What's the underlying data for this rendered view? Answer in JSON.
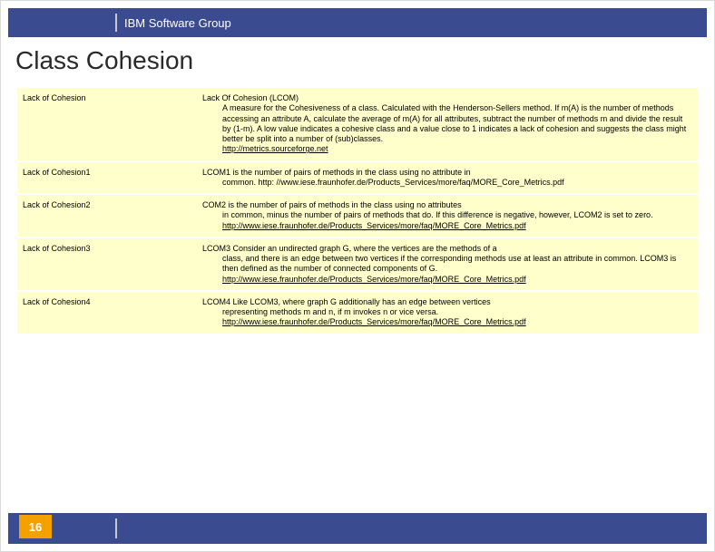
{
  "header": {
    "group": "IBM Software Group"
  },
  "title": "Class Cohesion",
  "page_number": "16",
  "rows": [
    {
      "name": "Lack of Cohesion",
      "head": "Lack Of Cohesion (LCOM)",
      "desc": "A measure for the Cohesiveness of a class. Calculated with the Henderson-Sellers method. If m(A) is the number of methods accessing an attribute A, calculate the average of m(A) for all attributes, subtract the number of methods m and divide the result by (1-m). A low value indicates a cohesive class and a value close to 1 indicates a lack of cohesion and suggests the class might better be split into a number of (sub)classes.",
      "link": "http://metrics.sourceforge.net"
    },
    {
      "name": "Lack of Cohesion1",
      "head": "LCOM1 is the number of pairs of methods in the class using no attribute in",
      "desc": "common. http: //www.iese.fraunhofer.de/Products_Services/more/faq/MORE_Core_Metrics.pdf",
      "link": ""
    },
    {
      "name": "Lack of Cohesion2",
      "head": "COM2 is the number of pairs of methods in the class using no attributes",
      "desc": "in common, minus the number of pairs of methods that do. If this difference is negative, however, LCOM2 is set to zero.",
      "link": "http://www.iese.fraunhofer.de/Products_Services/more/faq/MORE_Core_Metrics.pdf"
    },
    {
      "name": "Lack of Cohesion3",
      "head": "LCOM3 Consider an undirected graph G, where the vertices are the methods of a",
      "desc": "class, and there is an edge between two vertices if the corresponding methods use at least an attribute in common. LCOM3 is then defined as the number of connected components of G.",
      "link": "http://www.iese.fraunhofer.de/Products_Services/more/faq/MORE_Core_Metrics.pdf"
    },
    {
      "name": "Lack of Cohesion4",
      "head": "LCOM4 Like LCOM3, where graph G additionally has an edge between vertices",
      "desc": "representing methods m and n, if m invokes n or vice versa.",
      "link": "http://www.iese.fraunhofer.de/Products_Services/more/faq/MORE_Core_Metrics.pdf"
    }
  ]
}
